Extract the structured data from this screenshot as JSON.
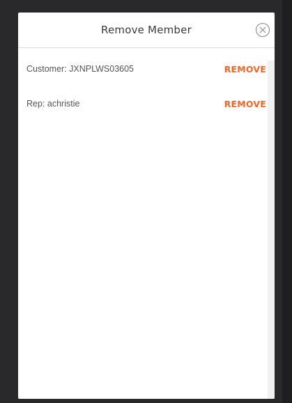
{
  "modal": {
    "title": "Remove Member",
    "close_icon": "close-circle-icon"
  },
  "members": [
    {
      "label": "Customer: JXNPLWS03605",
      "action": "REMOVE"
    },
    {
      "label": "Rep: achristie",
      "action": "REMOVE"
    }
  ],
  "colors": {
    "accent": "#f26522",
    "backdrop": "#29292b",
    "surface": "#ffffff"
  }
}
